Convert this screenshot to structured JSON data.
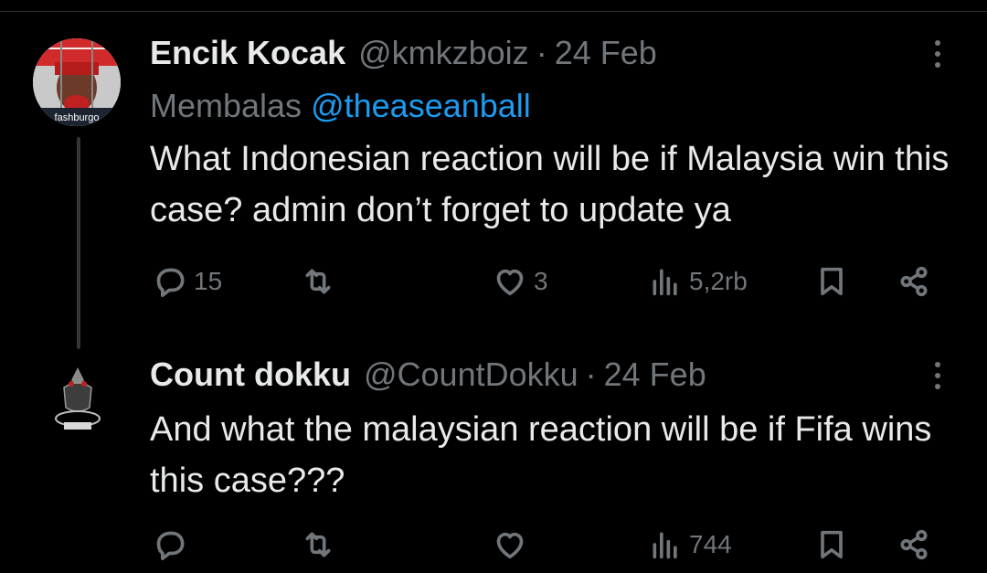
{
  "tweets": [
    {
      "name": "Encik Kocak",
      "handle": "@kmkzboiz",
      "separator": "·",
      "date": "24 Feb",
      "reply_prefix": "Membalas",
      "reply_mention": "@theaseanball",
      "text": "What Indonesian reaction will be if Malaysia win this case? admin don’t forget to update ya",
      "avatar_label": "fashburgo",
      "stats": {
        "replies": "15",
        "retweets": "",
        "likes": "3",
        "views": "5,2rb"
      }
    },
    {
      "name": "Count dokku",
      "handle": "@CountDokku",
      "separator": "·",
      "date": "24 Feb",
      "text": "And what the malaysian reaction will be if Fifa wins this case???",
      "stats": {
        "replies": "",
        "retweets": "",
        "likes": "",
        "views": "744"
      }
    }
  ],
  "colors": {
    "background": "#000000",
    "text": "#e7e9ea",
    "muted": "#71767b",
    "link": "#1d9bf0"
  },
  "icons": [
    "reply-icon",
    "retweet-icon",
    "like-icon",
    "views-icon",
    "bookmark-icon",
    "share-icon",
    "more-icon"
  ]
}
